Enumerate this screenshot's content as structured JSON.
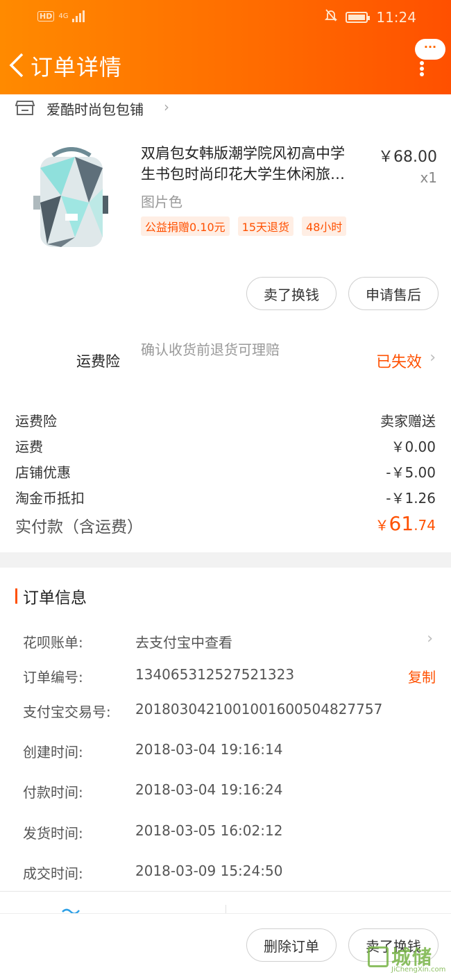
{
  "status_bar": {
    "network": "4G",
    "hd": "HD",
    "time": "11:24"
  },
  "header": {
    "title": "订单详情",
    "more_label": "···"
  },
  "shop": {
    "name": "爱酷时尚包包铺"
  },
  "product": {
    "title_line1": "双肩包女韩版潮学院风初高中学",
    "title_line2": "生书包时尚印花大学生休闲旅…",
    "price": "￥68.00",
    "qty": "x1",
    "sku": "图片色",
    "tags": [
      "公益捐赠0.10元",
      "15天退货",
      "48小时"
    ]
  },
  "item_actions": {
    "sell": "卖了换钱",
    "after_sale": "申请售后"
  },
  "insurance": {
    "label": "运费险",
    "desc": "确认收货前退货可理赔",
    "status": "已失效"
  },
  "fees": [
    {
      "k": "运费险",
      "v": "卖家赠送"
    },
    {
      "k": "运费",
      "v": "￥0.00"
    },
    {
      "k": "店铺优惠",
      "v": "-￥5.00"
    },
    {
      "k": "淘金币抵扣",
      "v": "-￥1.26"
    }
  ],
  "total": {
    "label": "实付款（含运费）",
    "currency": "￥",
    "int": "61",
    "dec": ".74"
  },
  "order_info": {
    "title": "订单信息",
    "huabei": {
      "k": "花呗账单:",
      "v": "去支付宝中查看"
    },
    "order_no": {
      "k": "订单编号:",
      "v": "134065312527521323",
      "action": "复制"
    },
    "alipay_no": {
      "k": "支付宝交易号:",
      "v": "2018030421001001600504827757"
    },
    "created": {
      "k": "创建时间:",
      "v": "2018-03-04 19:16:14"
    },
    "paid": {
      "k": "付款时间:",
      "v": "2018-03-04 19:16:24"
    },
    "shipped": {
      "k": "发货时间:",
      "v": "2018-03-05 16:02:12"
    },
    "closed": {
      "k": "成交时间:",
      "v": "2018-03-09 15:24:50"
    }
  },
  "bottom": {
    "delete": "删除订单",
    "sell": "卖了换钱"
  },
  "watermark": {
    "cn": "城储",
    "en": "JiChengXin.com"
  },
  "colors": {
    "accent": "#ff5000",
    "header_start": "#ff8a00",
    "header_end": "#ff5000"
  }
}
